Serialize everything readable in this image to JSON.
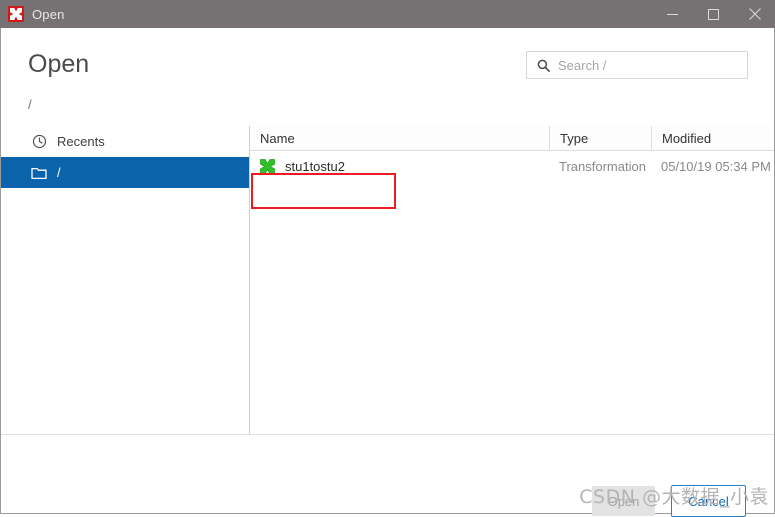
{
  "window": {
    "title": "Open",
    "app_icon": "pentaho-icon",
    "controls": [
      {
        "name": "minimize-button",
        "glyph": "minimize-icon"
      },
      {
        "name": "maximize-button",
        "glyph": "maximize-icon"
      },
      {
        "name": "close-button",
        "glyph": "close-icon"
      }
    ]
  },
  "dialog": {
    "heading": "Open",
    "breadcrumb": "/"
  },
  "search": {
    "placeholder": "Search /",
    "value": "",
    "icon": "search-icon"
  },
  "sidebar": {
    "items": [
      {
        "label": "Recents",
        "icon": "clock-icon",
        "selected": false
      },
      {
        "label": "/",
        "icon": "folder-icon",
        "selected": true
      }
    ]
  },
  "filelist": {
    "columns": [
      "Name",
      "Type",
      "Modified"
    ],
    "rows": [
      {
        "icon": "transformation-icon",
        "name": "stu1tostu2",
        "type": "Transformation",
        "modified": "05/10/19 05:34 PM"
      }
    ]
  },
  "footer": {
    "open_label": "Open",
    "cancel_label": "Cancel"
  },
  "watermark": {
    "text": "CSDN @大数据_小袁"
  },
  "colors": {
    "titlebar": "#767273",
    "accent_blue": "#0b63ac",
    "button_blue": "#0a68b4",
    "annotation_red": "#ee1b22",
    "app_icon_red": "#d11a1a",
    "transformation_green": "#2fc127"
  }
}
